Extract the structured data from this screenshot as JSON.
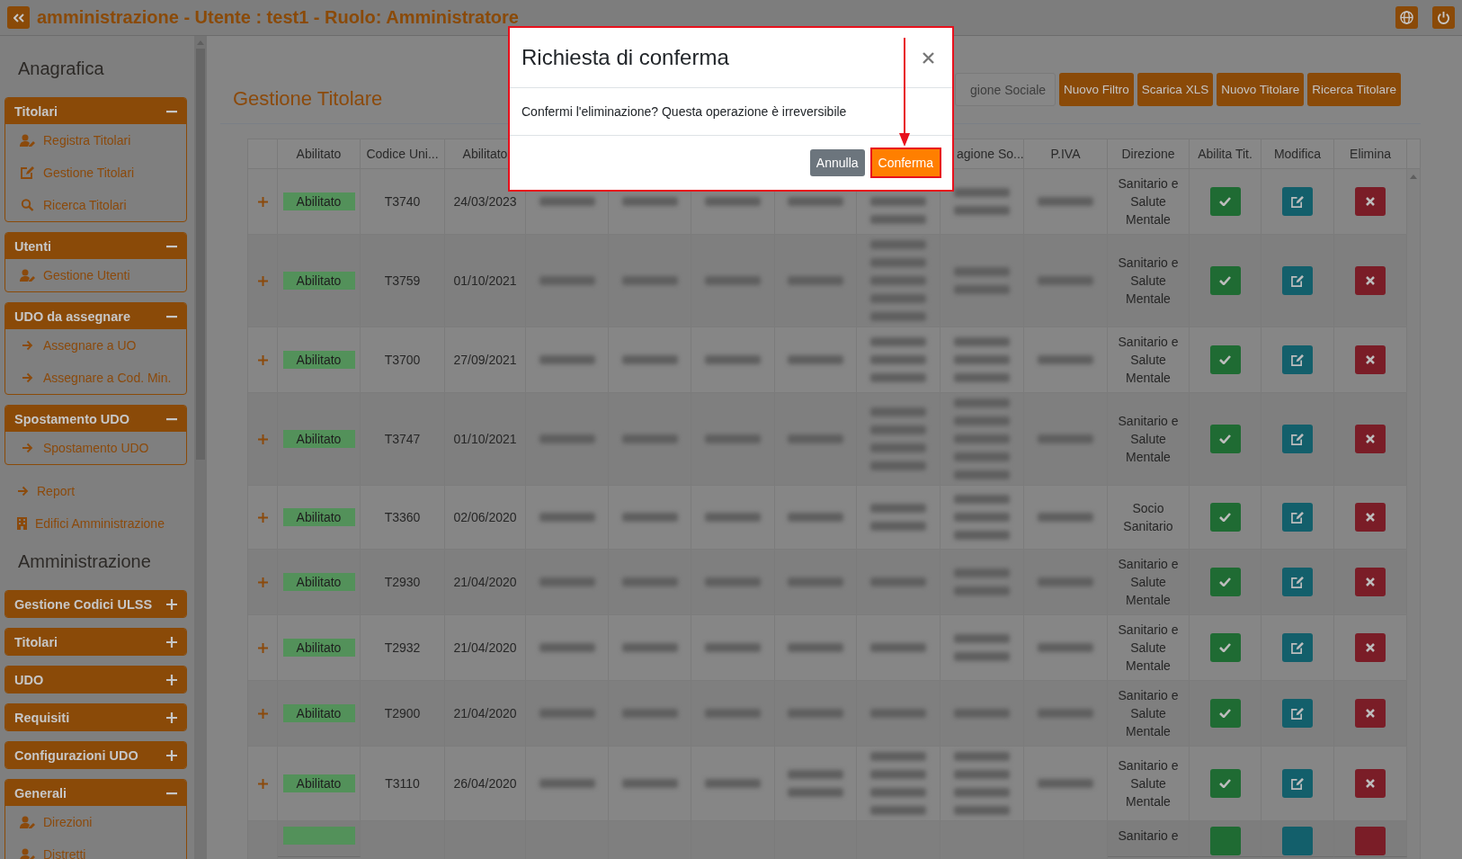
{
  "header": {
    "title": "amministrazione - Utente : test1 - Ruolo: Amministratore"
  },
  "sidebar": {
    "sections": [
      {
        "kind": "heading",
        "label": "Anagrafica"
      },
      {
        "kind": "panel",
        "title": "Titolari",
        "expanded": true,
        "items": [
          {
            "kind": "user",
            "label": "Registra Titolari"
          },
          {
            "kind": "edit",
            "label": "Gestione Titolari"
          },
          {
            "kind": "search",
            "label": "Ricerca Titolari"
          }
        ]
      },
      {
        "kind": "panel",
        "title": "Utenti",
        "expanded": true,
        "items": [
          {
            "kind": "user",
            "label": "Gestione Utenti"
          }
        ]
      },
      {
        "kind": "panel",
        "title": "UDO da assegnare",
        "expanded": true,
        "items": [
          {
            "kind": "arrow",
            "label": "Assegnare a UO"
          },
          {
            "kind": "arrow",
            "label": "Assegnare a Cod. Min."
          }
        ]
      },
      {
        "kind": "panel",
        "title": "Spostamento UDO",
        "expanded": true,
        "items": [
          {
            "kind": "arrow",
            "label": "Spostamento UDO"
          }
        ]
      },
      {
        "kind": "arrowlink",
        "label": "Report"
      },
      {
        "kind": "buildinglink",
        "label": "Edifici Amministrazione"
      },
      {
        "kind": "heading",
        "label": "Amministrazione"
      },
      {
        "kind": "panel",
        "title": "Gestione Codici ULSS",
        "expanded": false
      },
      {
        "kind": "panel",
        "title": "Titolari",
        "expanded": false
      },
      {
        "kind": "panel",
        "title": "UDO",
        "expanded": false
      },
      {
        "kind": "panel",
        "title": "Requisiti",
        "expanded": false
      },
      {
        "kind": "panel",
        "title": "Configurazioni UDO",
        "expanded": false
      },
      {
        "kind": "panel",
        "title": "Generali",
        "expanded": true,
        "items": [
          {
            "kind": "user",
            "label": "Direzioni"
          },
          {
            "kind": "user",
            "label": "Distretti"
          }
        ]
      }
    ]
  },
  "page": {
    "title": "Gestione Titolare",
    "search": {
      "placeholder": "gione Sociale"
    },
    "actions": [
      "Nuovo Filtro",
      "Scarica XLS",
      "Nuovo Titolare",
      "Ricerca Titolare"
    ]
  },
  "table": {
    "columns": [
      "Abilitato",
      "Codice Uni...",
      "Abilitato",
      "agione So...",
      "P.IVA",
      "Direzione",
      "Abilita Tit.",
      "Modifica",
      "Elimina"
    ],
    "rows": [
      {
        "status": "Abilitato",
        "code": "T3740",
        "date": "24/03/2023",
        "direzione": "Sanitario e Salute Mentale"
      },
      {
        "status": "Abilitato",
        "code": "T3759",
        "date": "01/10/2021",
        "direzione": "Sanitario e Salute Mentale"
      },
      {
        "status": "Abilitato",
        "code": "T3700",
        "date": "27/09/2021",
        "direzione": "Sanitario e Salute Mentale"
      },
      {
        "status": "Abilitato",
        "code": "T3747",
        "date": "01/10/2021",
        "direzione": "Sanitario e Salute Mentale"
      },
      {
        "status": "Abilitato",
        "code": "T3360",
        "date": "02/06/2020",
        "direzione": "Socio Sanitario"
      },
      {
        "status": "Abilitato",
        "code": "T2930",
        "date": "21/04/2020",
        "direzione": "Sanitario e Salute Mentale"
      },
      {
        "status": "Abilitato",
        "code": "T2932",
        "date": "21/04/2020",
        "direzione": "Sanitario e Salute Mentale"
      },
      {
        "status": "Abilitato",
        "code": "T2900",
        "date": "21/04/2020",
        "direzione": "Sanitario e Salute Mentale"
      },
      {
        "status": "Abilitato",
        "code": "T3110",
        "date": "26/04/2020",
        "direzione": "Sanitario e Salute Mentale"
      },
      {
        "partial": true,
        "direzione": "Sanitario e"
      }
    ]
  },
  "modal": {
    "title": "Richiesta di conferma",
    "message": "Confermi l'eliminazione? Questa operazione è irreversibile",
    "buttons": [
      {
        "label": "Annulla",
        "kind": "secondary",
        "highlighted": false
      },
      {
        "label": "Conferma",
        "kind": "primary",
        "highlighted": true
      }
    ]
  }
}
